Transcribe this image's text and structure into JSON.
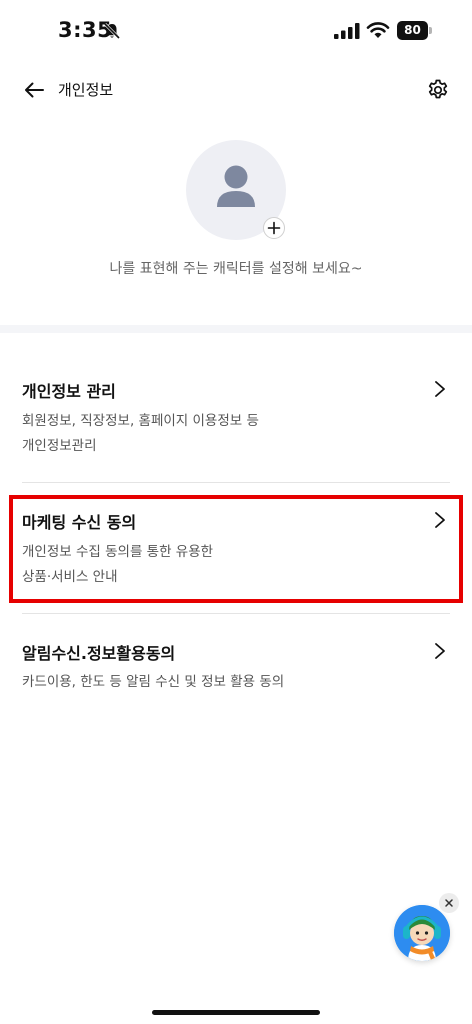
{
  "status_bar": {
    "time": "3:35",
    "battery_level": "80",
    "icons": [
      "bell-slash-icon",
      "cellular-signal-icon",
      "wifi-icon",
      "battery-icon"
    ]
  },
  "header": {
    "title": "개인정보",
    "back_icon": "arrow-left-icon",
    "settings_icon": "gear-icon"
  },
  "profile": {
    "hint": "나를 표현해 주는 캐릭터를 설정해 보세요~",
    "avatar_icon": "person-icon",
    "add_icon": "plus-icon"
  },
  "menu": {
    "items": [
      {
        "title": "개인정보 관리",
        "desc_lines": [
          "회원정보, 직장정보, 홈페이지 이용정보 등",
          "개인정보관리"
        ]
      },
      {
        "title": "마케팅 수신 동의",
        "desc_lines": [
          "개인정보 수집 동의를 통한 유용한",
          "상품·서비스 안내"
        ]
      },
      {
        "title": "알림수신.정보활용동의",
        "desc_lines": [
          "카드이용, 한도 등 알림 수신 및 정보 활용 동의"
        ]
      }
    ]
  },
  "floating": {
    "chatbot_icon": "chatbot-character-icon",
    "close_icon": "close-icon"
  },
  "colors": {
    "highlight": "#e60000",
    "avatar_bg": "#eeeff4",
    "avatar_fg": "#7e889f",
    "chatbot_bg": "#2d8cf0"
  }
}
